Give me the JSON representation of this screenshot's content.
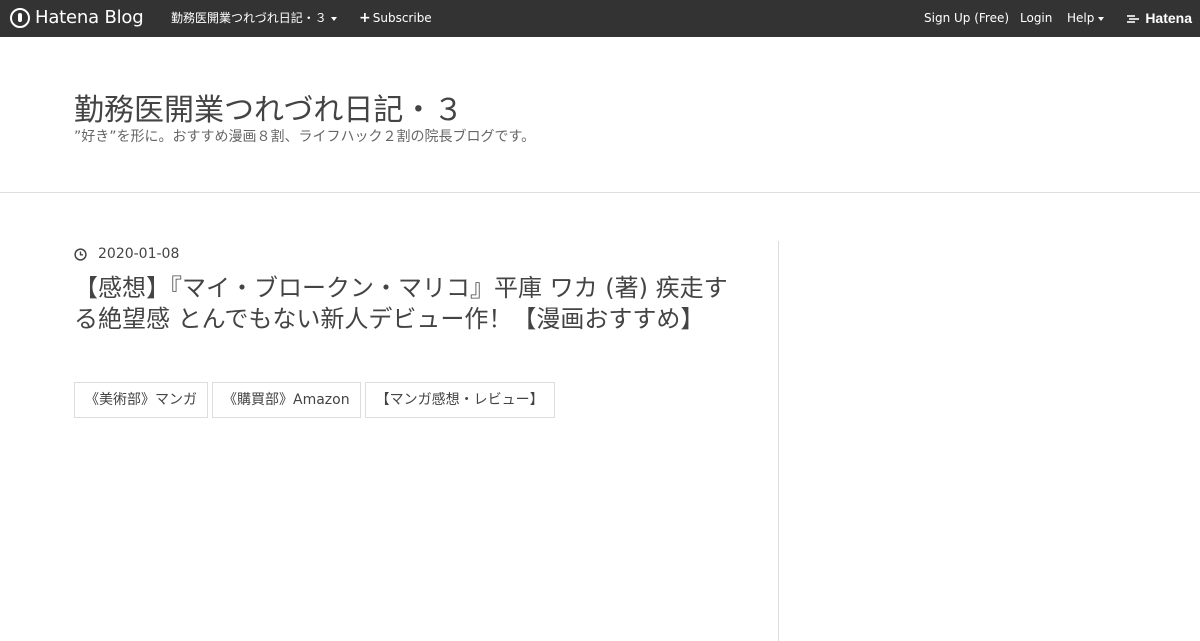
{
  "topbar": {
    "brand": "Hatena Blog",
    "blog_menu": "勤務医開業つれづれ日記・３",
    "subscribe": "Subscribe",
    "signup": "Sign Up (Free)",
    "login": "Login",
    "help": "Help",
    "hatena": "Hatena"
  },
  "blog": {
    "title": "勤務医開業つれづれ日記・３",
    "description": "”好き”を形に。おすすめ漫画８割、ライフハック２割の院長ブログです。"
  },
  "entry": {
    "date": "2020-01-08",
    "title": "【感想】『マイ・ブロークン・マリコ』平庫 ワカ (著) 疾走する絶望感 とんでもない新人デビュー作！【漫画おすすめ】",
    "categories": [
      {
        "label": "《美術部》マンガ"
      },
      {
        "label": "《購買部》Amazon"
      },
      {
        "label": "【マンガ感想・レビュー】"
      }
    ]
  },
  "colors": {
    "topbar_bg": "#333333",
    "text": "#444444",
    "border": "#dddddd"
  },
  "icons": {
    "brand": "hatena-blog-icon",
    "subscribe": "plus-icon",
    "date": "clock-icon",
    "hatena": "hatena-logo-icon"
  }
}
